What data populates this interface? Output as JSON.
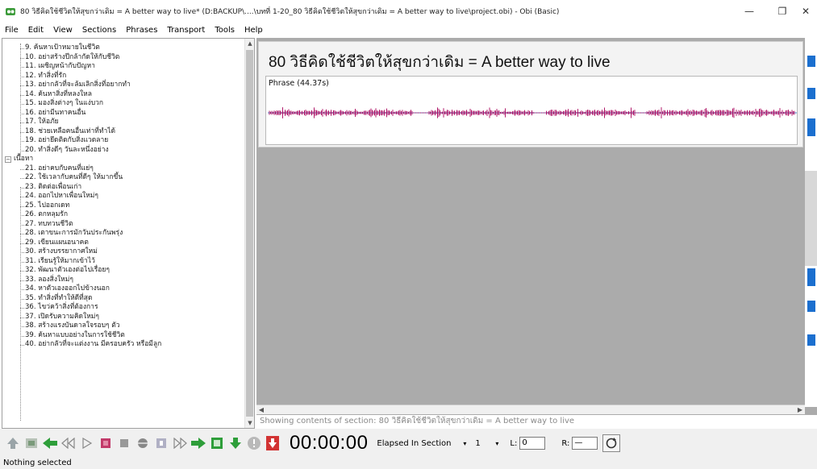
{
  "window": {
    "title": "80 วิธีคิดใช้ชีวิตให้สุขกว่าเดิม = A better way to live* (D:BACKUP\\....\\บทที่ 1-20_80 วิธีคิดใช้ชีวิตให้สุขกว่าเดิม = A better way to live\\project.obi) - Obi (Basic)",
    "minimize": "—",
    "maximize": "❐",
    "close": "✕"
  },
  "menu": [
    "File",
    "Edit",
    "View",
    "Sections",
    "Phrases",
    "Transport",
    "Tools",
    "Help"
  ],
  "tree": {
    "group_a_items": [
      "9. ค้นหาเป้าหมายในชีวิต",
      "10. อย่าสร้างปีกล้ากัดให้กับชีวิต",
      "11. เผชิญหน้ากับปัญหา",
      "12. ทำสิ่งที่รัก",
      "13. อย่ากลัวที่จะล้มเลิกสิ่งที่อยากทำ",
      "14. ค้นหาสิ่งที่หลงใหล",
      "15. มองสิ่งต่างๆ ในแง่บวก",
      "16. อย่ามีนทาคนอื่น",
      "17. ให้อภัย",
      "18. ช่วยเหลือคนอื่นเท่าที่ทำได้",
      "19. อย่ายึดติดกับสิ่งแวดลาย",
      "20. ทำสิ่งดีๆ วันละหนึ่งอย่าง"
    ],
    "section_label": "เนื้อหา",
    "group_b_items": [
      "21. อย่าคบกับคนที่แย่ๆ",
      "22. ใช้เวลากับคนที่ดีๆ ให้มากขึ้น",
      "23. ติดต่อเพื่อนเก่า",
      "24. ออกไปหาเพื่อนใหม่ๆ",
      "25. ไปออกเดท",
      "26. ตกหลุมรัก",
      "27. ทบทวนชีวิต",
      "28. เตาขนะการมักวันประกันพรุ่ง",
      "29. เขียนแผนอนาคต",
      "30. สร้างบรรยากาศใหม่",
      "31. เรียนรู้ให้มากเข้าไว้",
      "32. พัฒนาตัวเองต่อไปเรื่อยๆ",
      "33. ลองสิ่งใหม่ๆ",
      "34. หาตัวเองออกไปข้างนอก",
      "35. ทำสิ่งที่ทำให้ดีที่สุด",
      "36. ไขว่คว้าสิ่งที่ต้องการ",
      "37. เปิดรับความคิดใหม่ๆ",
      "38. สร้างแรงบันดาลใจรอบๆ ตัว",
      "39. ค้นหาแบบอย่างในการใช้ชีวิต",
      "40. อย่ากลัวที่จะแต่งงาน มีครอบครัว หรือมีลูก"
    ]
  },
  "content": {
    "section_title": "80 วิธีคิดใช้ชีวิตให้สุขกว่าเดิม = A better way to live",
    "phrase_label": "Phrase (44.37s)",
    "status_text": "Showing contents of section:  80 วิธีคิดใช้ชีวิตให้สุขกว่าเดิม = A better way to live",
    "waveform_color": "#b0196a"
  },
  "transport": {
    "time": "00:00:00",
    "time_mode": "Elapsed In Section",
    "level_value": "1",
    "l_label": "L:",
    "l_value": "0",
    "r_label": "R:",
    "r_value": "—"
  },
  "status_bar": "Nothing selected"
}
